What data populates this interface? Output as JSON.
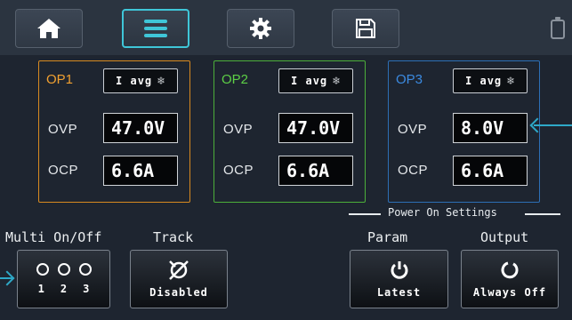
{
  "toolbar": {
    "buttons": [
      {
        "icon": "home-icon",
        "active": false
      },
      {
        "icon": "menu-icon",
        "active": true
      },
      {
        "icon": "gear-icon",
        "active": false
      },
      {
        "icon": "save-icon",
        "active": false
      }
    ],
    "status_icon": "battery-icon"
  },
  "outputs": [
    {
      "label": "OP1",
      "mode": "I avg",
      "mode_icon": "snowflake-icon",
      "ovp_label": "OVP",
      "ovp": "47.0V",
      "ocp_label": "OCP",
      "ocp": "6.6A",
      "color": "#d88a20"
    },
    {
      "label": "OP2",
      "mode": "I avg",
      "mode_icon": "snowflake-icon",
      "ovp_label": "OVP",
      "ovp": "47.0V",
      "ocp_label": "OCP",
      "ocp": "6.6A",
      "color": "#4caf3a"
    },
    {
      "label": "OP3",
      "mode": "I avg",
      "mode_icon": "snowflake-icon",
      "ovp_label": "OVP",
      "ovp": "8.0V",
      "ocp_label": "OCP",
      "ocp": "6.6A",
      "color": "#2d6fb5"
    }
  ],
  "controls": {
    "multi": {
      "title": "Multi On/Off",
      "channels": [
        "1",
        "2",
        "3"
      ]
    },
    "track": {
      "title": "Track",
      "value": "Disabled",
      "icon": "no-track-icon"
    },
    "power_on_settings": {
      "title": "Power On Settings"
    },
    "param": {
      "title": "Param",
      "value": "Latest",
      "icon": "power-icon"
    },
    "output": {
      "title": "Output",
      "value": "Always Off",
      "icon": "power-off-icon"
    }
  },
  "colors": {
    "accent": "#3fc6d8",
    "arrow": "#2ea9c8"
  }
}
